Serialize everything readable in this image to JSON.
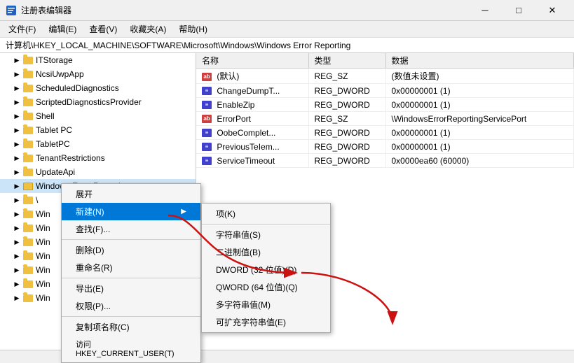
{
  "titleBar": {
    "title": "注册表编辑器",
    "controls": {
      "minimize": "─",
      "maximize": "□",
      "close": "✕"
    }
  },
  "menuBar": {
    "items": [
      "文件(F)",
      "编辑(E)",
      "查看(V)",
      "收藏夹(A)",
      "帮助(H)"
    ]
  },
  "addressBar": {
    "path": "计算机\\HKEY_LOCAL_MACHINE\\SOFTWARE\\Microsoft\\Windows\\Windows Error Reporting"
  },
  "treeItems": [
    {
      "label": "ITStorage",
      "indent": 2,
      "expanded": false
    },
    {
      "label": "NcsiUwpApp",
      "indent": 2,
      "expanded": false
    },
    {
      "label": "ScheduledDiagnostics",
      "indent": 2,
      "expanded": false
    },
    {
      "label": "ScriptedDiagnosticsProvider",
      "indent": 2,
      "expanded": false
    },
    {
      "label": "Shell",
      "indent": 2,
      "expanded": false
    },
    {
      "label": "Tablet PC",
      "indent": 2,
      "expanded": false
    },
    {
      "label": "TabletPC",
      "indent": 2,
      "expanded": false
    },
    {
      "label": "TenantRestrictions",
      "indent": 2,
      "expanded": false
    },
    {
      "label": "UpdateApi",
      "indent": 2,
      "expanded": false
    },
    {
      "label": "Windows Error Reporting",
      "indent": 2,
      "expanded": true,
      "selected": true,
      "contextOpen": true
    },
    {
      "label": "\\",
      "indent": 2,
      "expanded": false
    },
    {
      "label": "Win",
      "indent": 2,
      "expanded": false
    },
    {
      "label": "Win",
      "indent": 2,
      "expanded": false
    },
    {
      "label": "Win",
      "indent": 2,
      "expanded": false
    },
    {
      "label": "Win",
      "indent": 2,
      "expanded": false
    },
    {
      "label": "Win",
      "indent": 2,
      "expanded": false
    },
    {
      "label": "Win",
      "indent": 2,
      "expanded": false
    },
    {
      "label": "Win",
      "indent": 2,
      "expanded": false
    }
  ],
  "tableHeaders": [
    "名称",
    "类型",
    "数据"
  ],
  "tableRows": [
    {
      "icon": "ab",
      "name": "(默认)",
      "type": "REG_SZ",
      "data": "(数值未设置)"
    },
    {
      "icon": "dword",
      "name": "ChangeDumpT...",
      "type": "REG_DWORD",
      "data": "0x00000001 (1)"
    },
    {
      "icon": "dword",
      "name": "EnableZip",
      "type": "REG_DWORD",
      "data": "0x00000001 (1)"
    },
    {
      "icon": "ab",
      "name": "ErrorPort",
      "type": "REG_SZ",
      "data": "\\WindowsErrorReportingServicePort"
    },
    {
      "icon": "dword",
      "name": "OobeComplet...",
      "type": "REG_DWORD",
      "data": "0x00000001 (1)"
    },
    {
      "icon": "dword",
      "name": "PreviousTeIem...",
      "type": "REG_DWORD",
      "data": "0x00000001 (1)"
    },
    {
      "icon": "dword",
      "name": "ServiceTimeout",
      "type": "REG_DWORD",
      "data": "0x0000ea60 (60000)"
    }
  ],
  "contextMenu": {
    "items": [
      {
        "label": "展开",
        "shortcut": "",
        "hasSubmenu": false,
        "separator_after": false
      },
      {
        "label": "新建(N)",
        "shortcut": "",
        "hasSubmenu": true,
        "separator_after": false,
        "highlighted": true
      },
      {
        "label": "查找(F)...",
        "shortcut": "",
        "hasSubmenu": false,
        "separator_after": true
      },
      {
        "label": "删除(D)",
        "shortcut": "",
        "hasSubmenu": false,
        "separator_after": false
      },
      {
        "label": "重命名(R)",
        "shortcut": "",
        "hasSubmenu": false,
        "separator_after": true
      },
      {
        "label": "导出(E)",
        "shortcut": "",
        "hasSubmenu": false,
        "separator_after": false
      },
      {
        "label": "权限(P)...",
        "shortcut": "",
        "hasSubmenu": false,
        "separator_after": true
      },
      {
        "label": "复制项名称(C)",
        "shortcut": "",
        "hasSubmenu": false,
        "separator_after": false
      },
      {
        "label": "访问 HKEY_CURRENT_USER(T)",
        "shortcut": "",
        "hasSubmenu": false,
        "separator_after": false
      }
    ]
  },
  "submenu": {
    "items": [
      {
        "label": "项(K)",
        "separator_after": true
      },
      {
        "label": "字符串值(S)",
        "separator_after": false
      },
      {
        "label": "二进制值(B)",
        "separator_after": false
      },
      {
        "label": "DWORD (32 位值)(D)",
        "separator_after": false
      },
      {
        "label": "QWORD (64 位值)(Q)",
        "separator_after": false
      },
      {
        "label": "多字符串值(M)",
        "separator_after": false
      },
      {
        "label": "可扩充字符串值(E)",
        "separator_after": false
      }
    ]
  },
  "statusBar": {
    "text": ""
  }
}
